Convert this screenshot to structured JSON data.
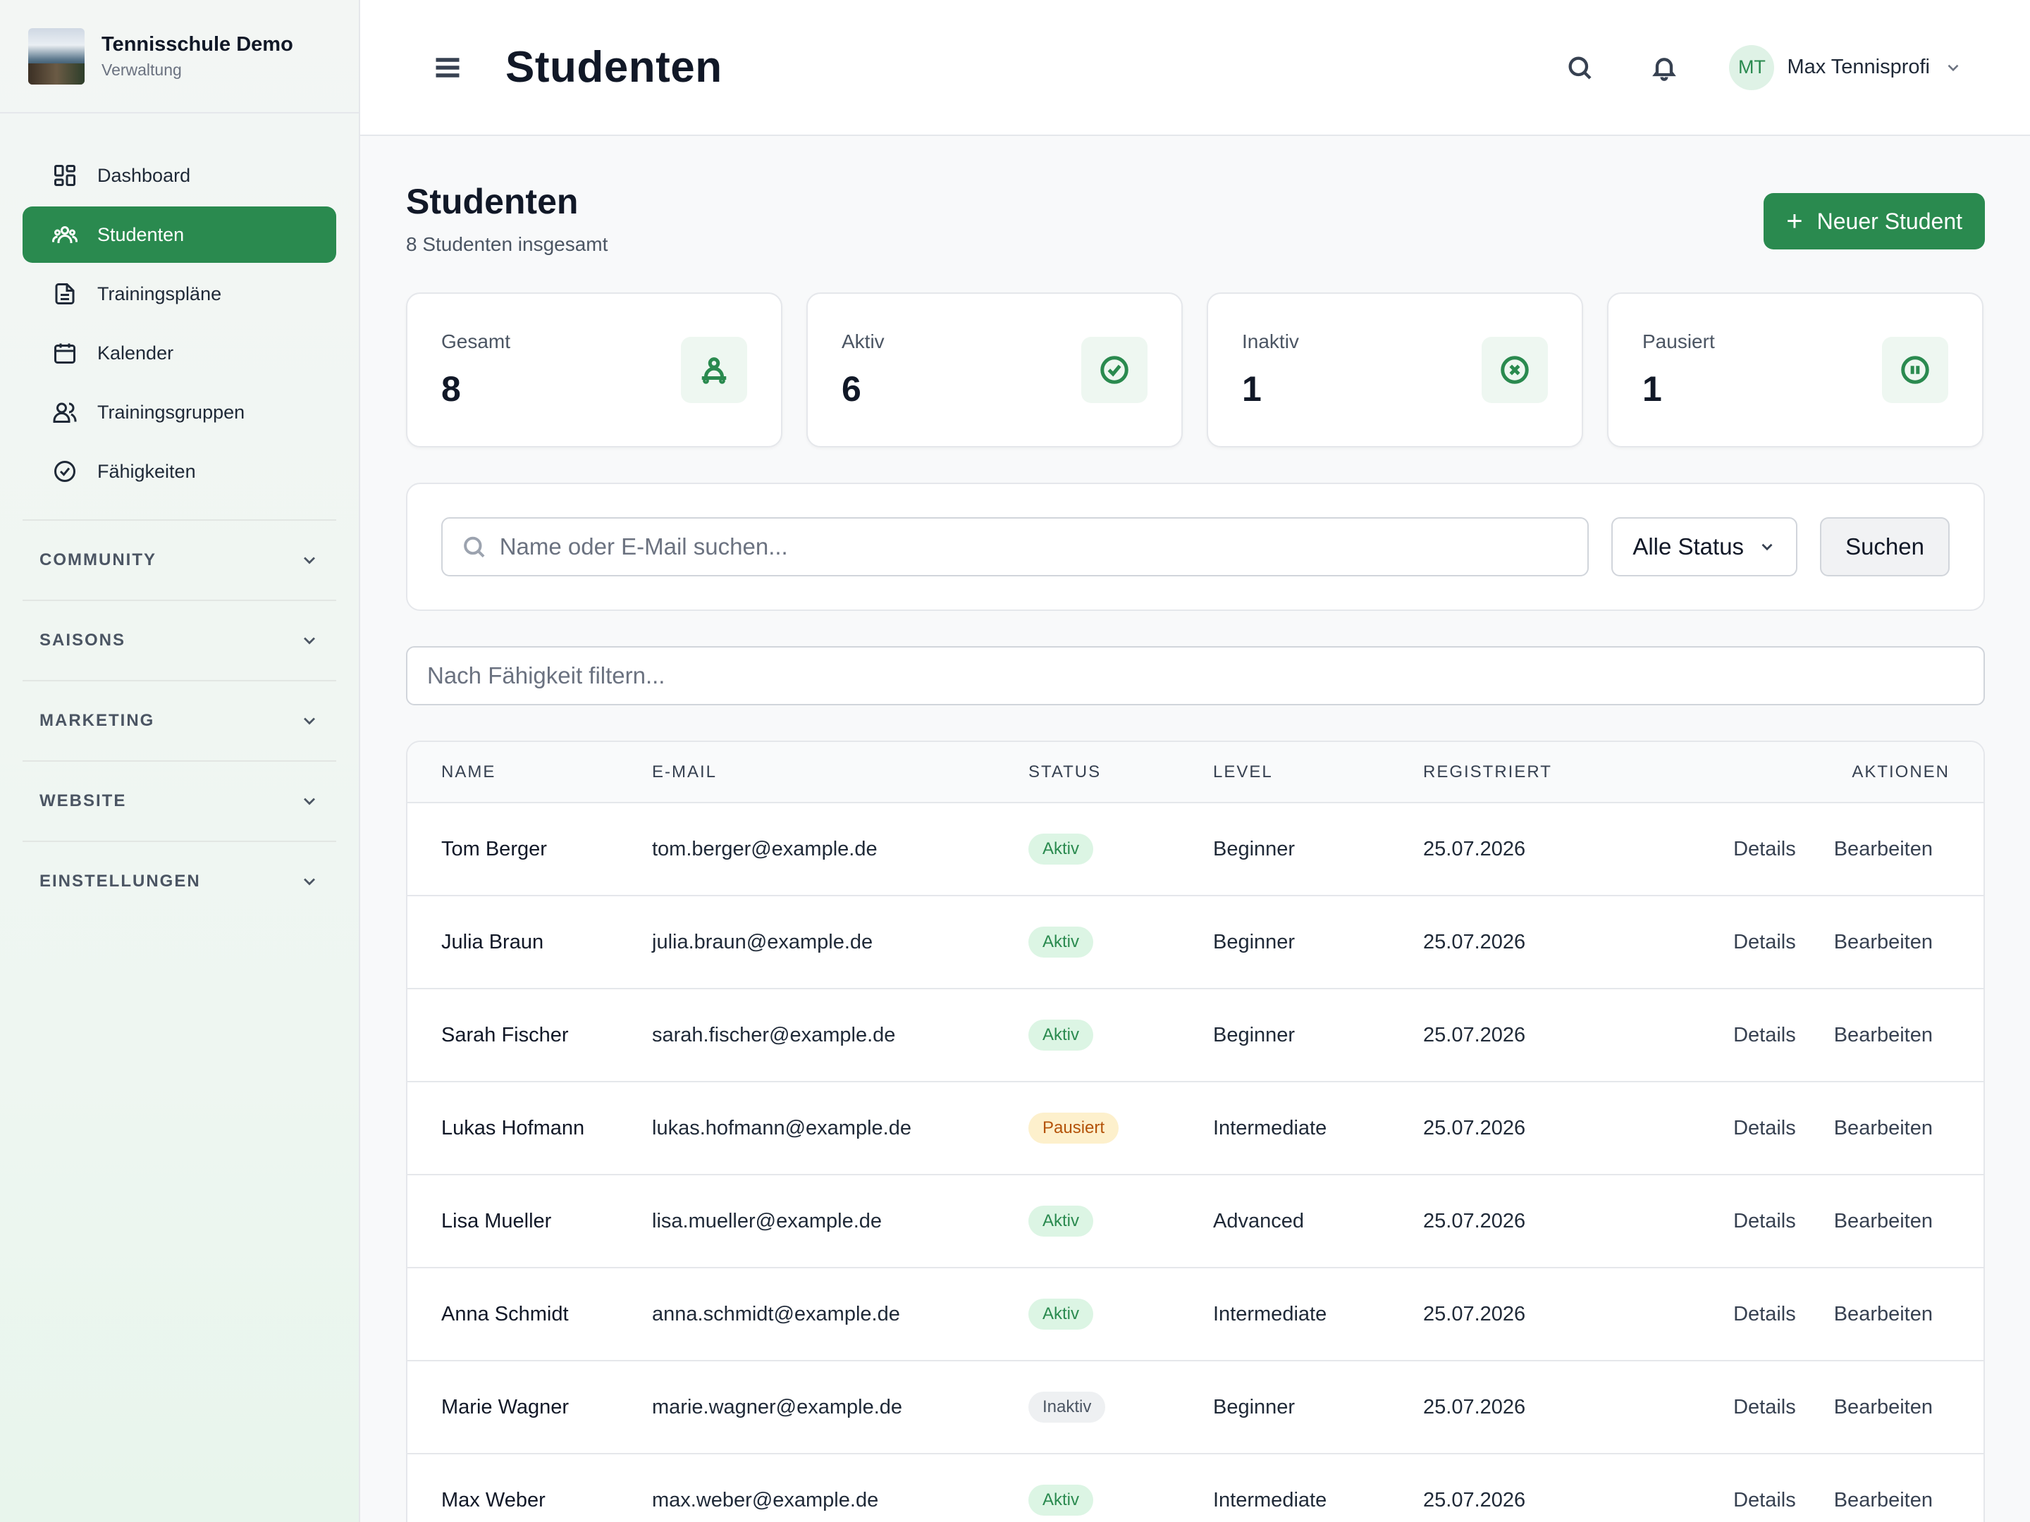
{
  "brand": {
    "title": "Tennisschule Demo",
    "subtitle": "Verwaltung"
  },
  "nav": {
    "items": [
      {
        "label": "Dashboard",
        "icon": "dashboard-icon",
        "active": false
      },
      {
        "label": "Studenten",
        "icon": "users-icon",
        "active": true
      },
      {
        "label": "Trainingspläne",
        "icon": "document-icon",
        "active": false
      },
      {
        "label": "Kalender",
        "icon": "calendar-icon",
        "active": false
      },
      {
        "label": "Trainingsgruppen",
        "icon": "group-icon",
        "active": false
      },
      {
        "label": "Fähigkeiten",
        "icon": "check-circle-icon",
        "active": false
      }
    ],
    "sections": [
      "COMMUNITY",
      "SAISONS",
      "MARKETING",
      "WEBSITE",
      "EINSTELLUNGEN"
    ]
  },
  "header": {
    "title": "Studenten",
    "user": {
      "initials": "MT",
      "name": "Max Tennisprofi"
    }
  },
  "main": {
    "title": "Studenten",
    "subtitle": "8 Studenten insgesamt",
    "new_button": "Neuer Student",
    "new_button_icon": "+"
  },
  "stats": [
    {
      "label": "Gesamt",
      "value": "8",
      "icon": "person-icon"
    },
    {
      "label": "Aktiv",
      "value": "6",
      "icon": "check-circle-icon"
    },
    {
      "label": "Inaktiv",
      "value": "1",
      "icon": "x-circle-icon"
    },
    {
      "label": "Pausiert",
      "value": "1",
      "icon": "pause-circle-icon"
    }
  ],
  "search": {
    "placeholder": "Name oder E-Mail suchen...",
    "status_selected": "Alle Status",
    "button": "Suchen"
  },
  "skill_filter": {
    "placeholder": "Nach Fähigkeit filtern..."
  },
  "table": {
    "columns": [
      "NAME",
      "E-MAIL",
      "STATUS",
      "LEVEL",
      "REGISTRIERT",
      "AKTIONEN"
    ],
    "action_details": "Details",
    "action_edit": "Bearbeiten",
    "rows": [
      {
        "name": "Tom Berger",
        "email": "tom.berger@example.de",
        "status": "Aktiv",
        "status_kind": "aktiv",
        "level": "Beginner",
        "registered": "25.07.2026"
      },
      {
        "name": "Julia Braun",
        "email": "julia.braun@example.de",
        "status": "Aktiv",
        "status_kind": "aktiv",
        "level": "Beginner",
        "registered": "25.07.2026"
      },
      {
        "name": "Sarah Fischer",
        "email": "sarah.fischer@example.de",
        "status": "Aktiv",
        "status_kind": "aktiv",
        "level": "Beginner",
        "registered": "25.07.2026"
      },
      {
        "name": "Lukas Hofmann",
        "email": "lukas.hofmann@example.de",
        "status": "Pausiert",
        "status_kind": "pausiert",
        "level": "Intermediate",
        "registered": "25.07.2026"
      },
      {
        "name": "Lisa Mueller",
        "email": "lisa.mueller@example.de",
        "status": "Aktiv",
        "status_kind": "aktiv",
        "level": "Advanced",
        "registered": "25.07.2026"
      },
      {
        "name": "Anna Schmidt",
        "email": "anna.schmidt@example.de",
        "status": "Aktiv",
        "status_kind": "aktiv",
        "level": "Intermediate",
        "registered": "25.07.2026"
      },
      {
        "name": "Marie Wagner",
        "email": "marie.wagner@example.de",
        "status": "Inaktiv",
        "status_kind": "inaktiv",
        "level": "Beginner",
        "registered": "25.07.2026"
      },
      {
        "name": "Max Weber",
        "email": "max.weber@example.de",
        "status": "Aktiv",
        "status_kind": "aktiv",
        "level": "Intermediate",
        "registered": "25.07.2026"
      }
    ]
  },
  "colors": {
    "accent": "#2a8a4f",
    "accent_light": "#dcf5e4",
    "paused": "#fdf0cc",
    "inactive": "#eef0f2"
  }
}
